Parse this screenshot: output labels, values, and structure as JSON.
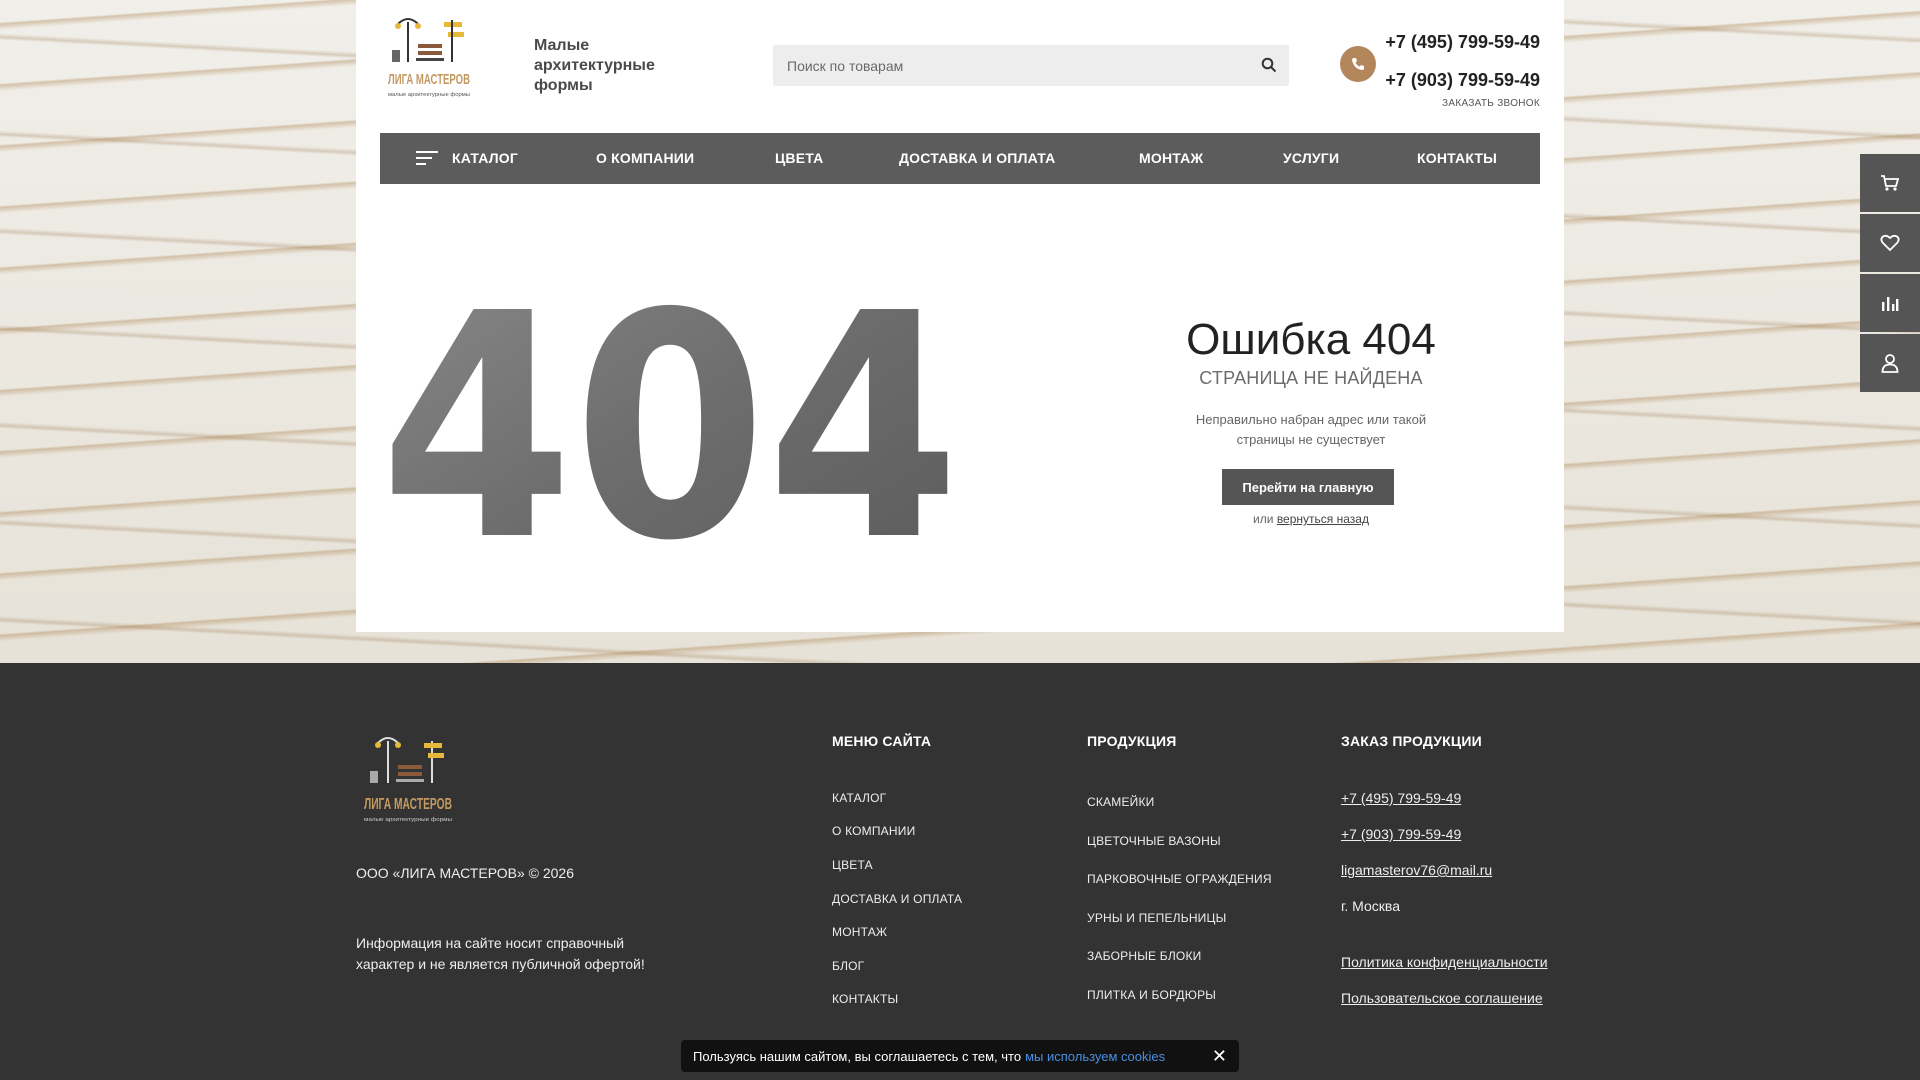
{
  "header": {
    "logo_text_main": "ЛИГА МАСТЕРОВ",
    "logo_text_sub": "малые архитектурные формы",
    "tagline": "Малые архитектурные формы",
    "search_placeholder": "Поиск по товарам",
    "phone1": "+7 (495) 799-59-49",
    "phone2": "+7 (903) 799-59-49",
    "callback": "ЗАКАЗАТЬ ЗВОНОК",
    "accent_color": "#b4865c"
  },
  "nav": {
    "items": [
      "КАТАЛОГ",
      "О КОМПАНИИ",
      "ЦВЕТА",
      "ДОСТАВКА И ОПЛАТА",
      "МОНТАЖ",
      "УСЛУГИ",
      "КОНТАКТЫ"
    ]
  },
  "error": {
    "code": "404",
    "title": "Ошибка 404",
    "subtitle": "СТРАНИЦА НЕ НАЙДЕНА",
    "description": "Неправильно набран адрес или такой страницы не существует",
    "home_button": "Перейти на главную",
    "or_text": "или",
    "back_link": "вернуться назад"
  },
  "side_panel": [
    "cart-icon",
    "heart-icon",
    "compare-icon",
    "user-icon"
  ],
  "footer": {
    "copyright": "ООО «ЛИГА МАСТЕРОВ» © 2026",
    "info": "Информация на сайте носит справочный характер и не является публичной офертой!",
    "menu_title": "МЕНЮ САЙТА",
    "menu": [
      "КАТАЛОГ",
      "О КОМПАНИИ",
      "ЦВЕТА",
      "ДОСТАВКА И ОПЛАТА",
      "МОНТАЖ",
      "БЛОГ",
      "КОНТАКТЫ"
    ],
    "products_title": "ПРОДУКЦИЯ",
    "products": [
      "СКАМЕЙКИ",
      "ЦВЕТОЧНЫЕ ВАЗОНЫ",
      "ПАРКОВОЧНЫЕ ОГРАЖДЕНИЯ",
      "УРНЫ И ПЕПЕЛЬНИЦЫ",
      "ЗАБОРНЫЕ БЛОКИ",
      "ПЛИТКА И БОРДЮРЫ"
    ],
    "order_title": "ЗАКАЗ ПРОДУКЦИИ",
    "order_phone1": "+7 (495) 799-59-49",
    "order_phone2": "+7 (903) 799-59-49",
    "order_email": "ligamasterov76@mail.ru",
    "order_city": "г. Москва",
    "privacy": "Политика конфиденциальности",
    "agreement": "Пользовательское соглашение"
  },
  "cookie": {
    "text": "Пользуясь нашим сайтом, вы соглашаетесь с тем, что",
    "link": "мы используем cookies",
    "close": "✕"
  }
}
